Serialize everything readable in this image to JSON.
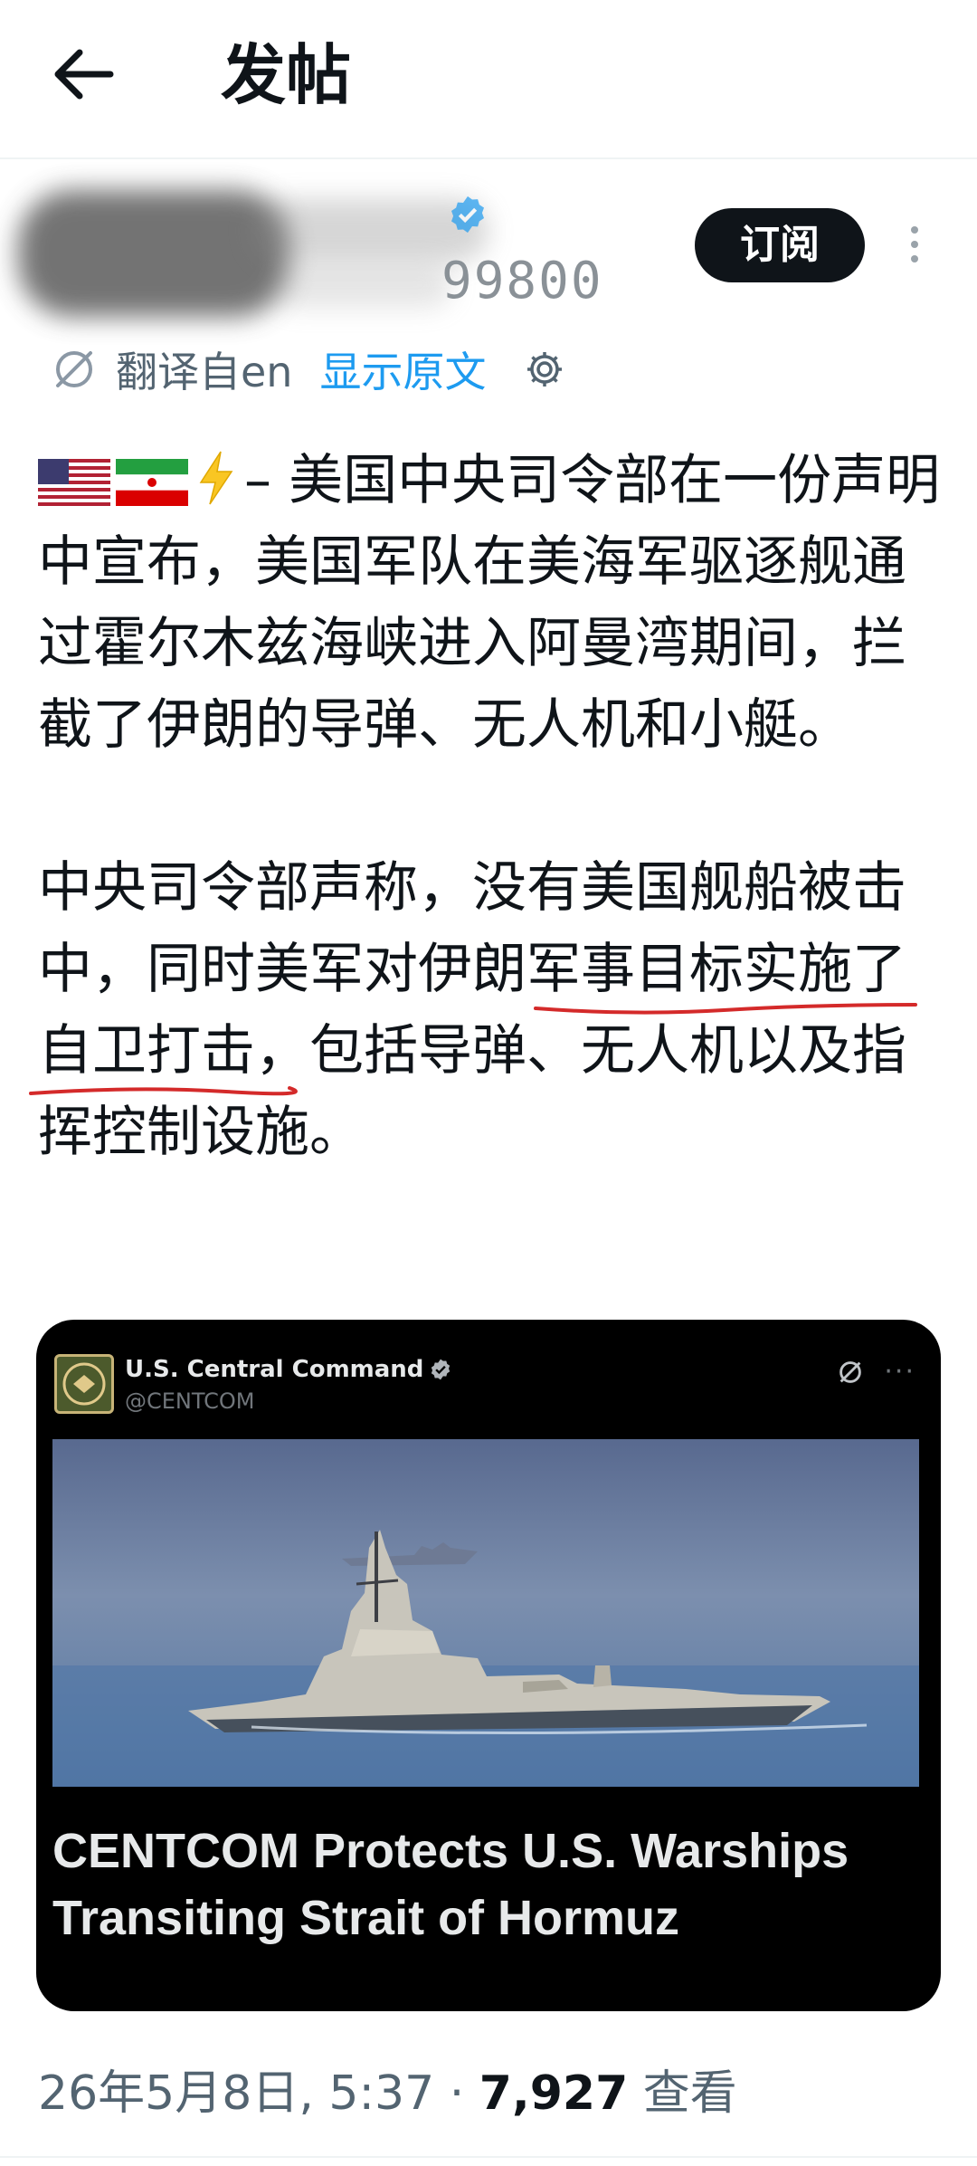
{
  "header": {
    "title": "发帖"
  },
  "author": {
    "handle_visible": "99800",
    "subscribe_label": "订阅"
  },
  "translation": {
    "from_label": "翻译自en",
    "show_original_label": "显示原文"
  },
  "post": {
    "paragraph1_rest": "– 美国中央司令部在一份声明中宣布，美国军队在美海军驱逐舰通过霍尔木兹海峡进入阿曼湾期间，拦截了伊朗的导弹、无人机和小艇。",
    "paragraph2_prefix": "中央司令部声称，",
    "paragraph2_underlined": "没有美国舰船被击中，",
    "paragraph2_rest": "同时美军对伊朗军事目标实施了自卫打击，包括导弹、无人机以及指挥控制设施。"
  },
  "card": {
    "name": "U.S. Central Command",
    "handle": "@CENTCOM",
    "headline_line1": "CENTCOM Protects U.S. Warships",
    "headline_line2": "Transiting Strait of Hormuz"
  },
  "meta": {
    "datetime": "26年5月8日, 5:37 · ",
    "views_count": "7,927",
    "views_label": " 查看"
  },
  "colors": {
    "accent": "#1d9bf0",
    "text": "#0f1419",
    "muted": "#536471",
    "underline": "#d42a2a"
  },
  "icons": [
    "back-arrow-icon",
    "verified-badge-icon",
    "translate-icon",
    "gear-icon",
    "more-vertical-icon",
    "us-flag-icon",
    "iran-flag-icon",
    "lightning-icon"
  ]
}
